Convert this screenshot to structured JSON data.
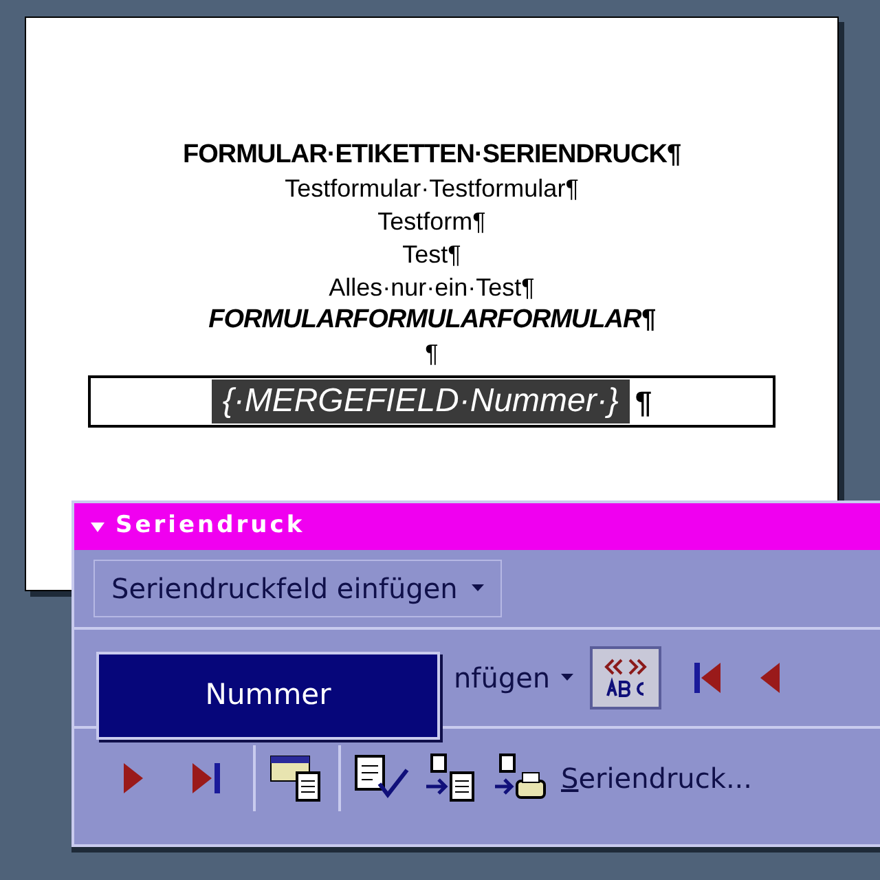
{
  "document": {
    "lines": [
      {
        "kind": "bold",
        "text": "FORMULAR·ETIKETTEN·SERIENDRUCK¶"
      },
      {
        "kind": "plain",
        "text": "Testformular·Testformular¶"
      },
      {
        "kind": "plain",
        "text": "Testform¶"
      },
      {
        "kind": "plain",
        "text": "Test¶"
      },
      {
        "kind": "plain",
        "text": "Alles·nur·ein·Test¶"
      },
      {
        "kind": "bolditalic",
        "text": "FORMULARFORMULARFORMULAR¶"
      },
      {
        "kind": "plain",
        "text": "¶"
      }
    ],
    "field": {
      "code": "{·MERGEFIELD·Nummer·}",
      "mark": "¶"
    }
  },
  "toolbar": {
    "title": "Seriendruck",
    "insert_field": "Seriendruckfeld einfügen",
    "insert_word": "nfügen",
    "abc_pressed": true,
    "mail_merge": "Seriendruck..."
  },
  "popup": {
    "items": [
      {
        "label": "Nummer",
        "selected": true
      }
    ]
  }
}
